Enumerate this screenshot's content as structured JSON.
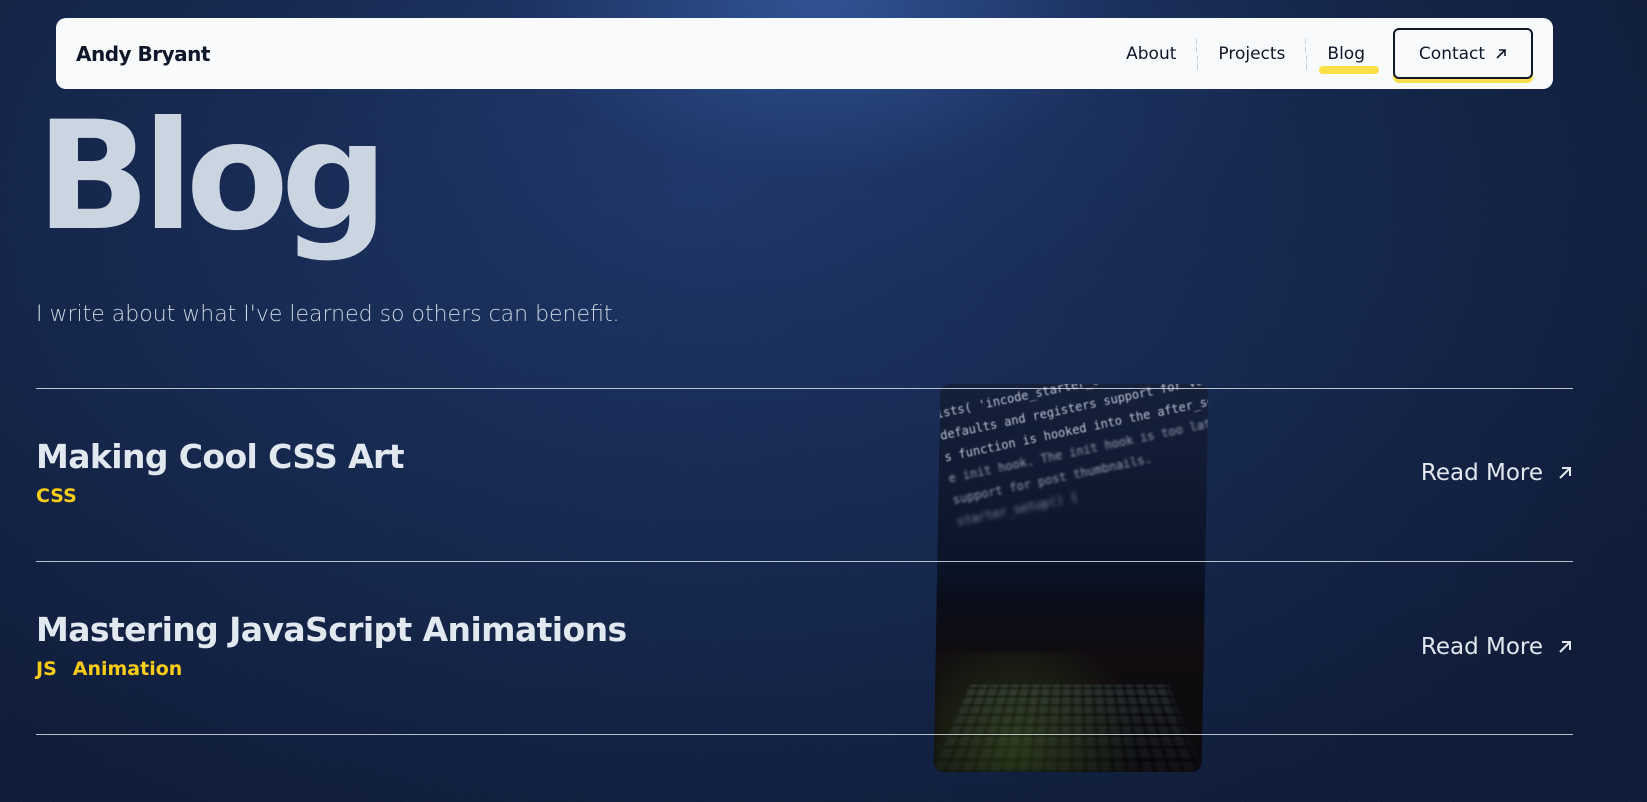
{
  "nav": {
    "brand": "Andy Bryant",
    "links": [
      {
        "label": "About"
      },
      {
        "label": "Projects"
      },
      {
        "label": "Blog"
      }
    ],
    "active": "Blog",
    "contact_label": "Contact"
  },
  "hero": {
    "title": "Blog",
    "subtitle": "I write about what I've learned so others can benefit."
  },
  "posts": [
    {
      "title": "Making Cool CSS Art",
      "tags": [
        "CSS"
      ],
      "cta": "Read More"
    },
    {
      "title": "Mastering JavaScript Animations",
      "tags": [
        "JS",
        "Animation"
      ],
      "cta": "Read More"
    }
  ],
  "preview": {
    "code_lines": [
      "ists( 'incode_starter_setup' ) );",
      "defaults and registers support for various WordPress",
      "s function is hooked into the after_setup_theme",
      "e init hook. The init hook is too late for some",
      "support for post thumbnails.",
      "starter_setup() {"
    ]
  },
  "colors": {
    "accent": "#fde047",
    "tag": "#facc15",
    "nav_bg": "#f8fafc",
    "bg_dark": "#0f1c39"
  },
  "icons": {
    "external_arrow": "arrow-up-right-icon"
  }
}
